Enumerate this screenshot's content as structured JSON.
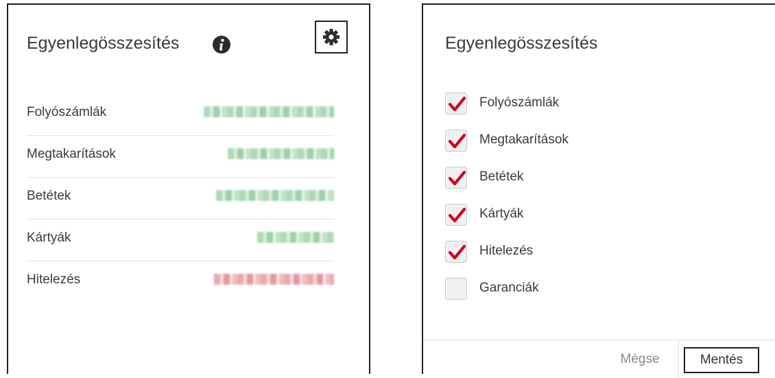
{
  "summary_panel": {
    "title": "Egyenlegösszesítés",
    "rows": [
      {
        "label": "Folyószámlák",
        "status": "positive"
      },
      {
        "label": "Megtakarítások",
        "status": "positive"
      },
      {
        "label": "Betétek",
        "status": "positive"
      },
      {
        "label": "Kártyák",
        "status": "positive"
      },
      {
        "label": "Hitelezés",
        "status": "negative"
      }
    ],
    "info_icon": "info-circle-icon",
    "settings_icon": "gear-icon"
  },
  "settings_panel": {
    "title": "Egyenlegösszesítés",
    "options": [
      {
        "label": "Folyószámlák",
        "checked": true
      },
      {
        "label": "Megtakarítások",
        "checked": true
      },
      {
        "label": "Betétek",
        "checked": true
      },
      {
        "label": "Kártyák",
        "checked": true
      },
      {
        "label": "Hitelezés",
        "checked": true
      },
      {
        "label": "Garanciák",
        "checked": false
      }
    ],
    "cancel_label": "Mégse",
    "save_label": "Mentés"
  },
  "colors": {
    "check_red": "#d0021b",
    "positive_green": "#9fd4a8",
    "negative_red": "#e89aa3",
    "border_dark": "#1f1f1f"
  }
}
